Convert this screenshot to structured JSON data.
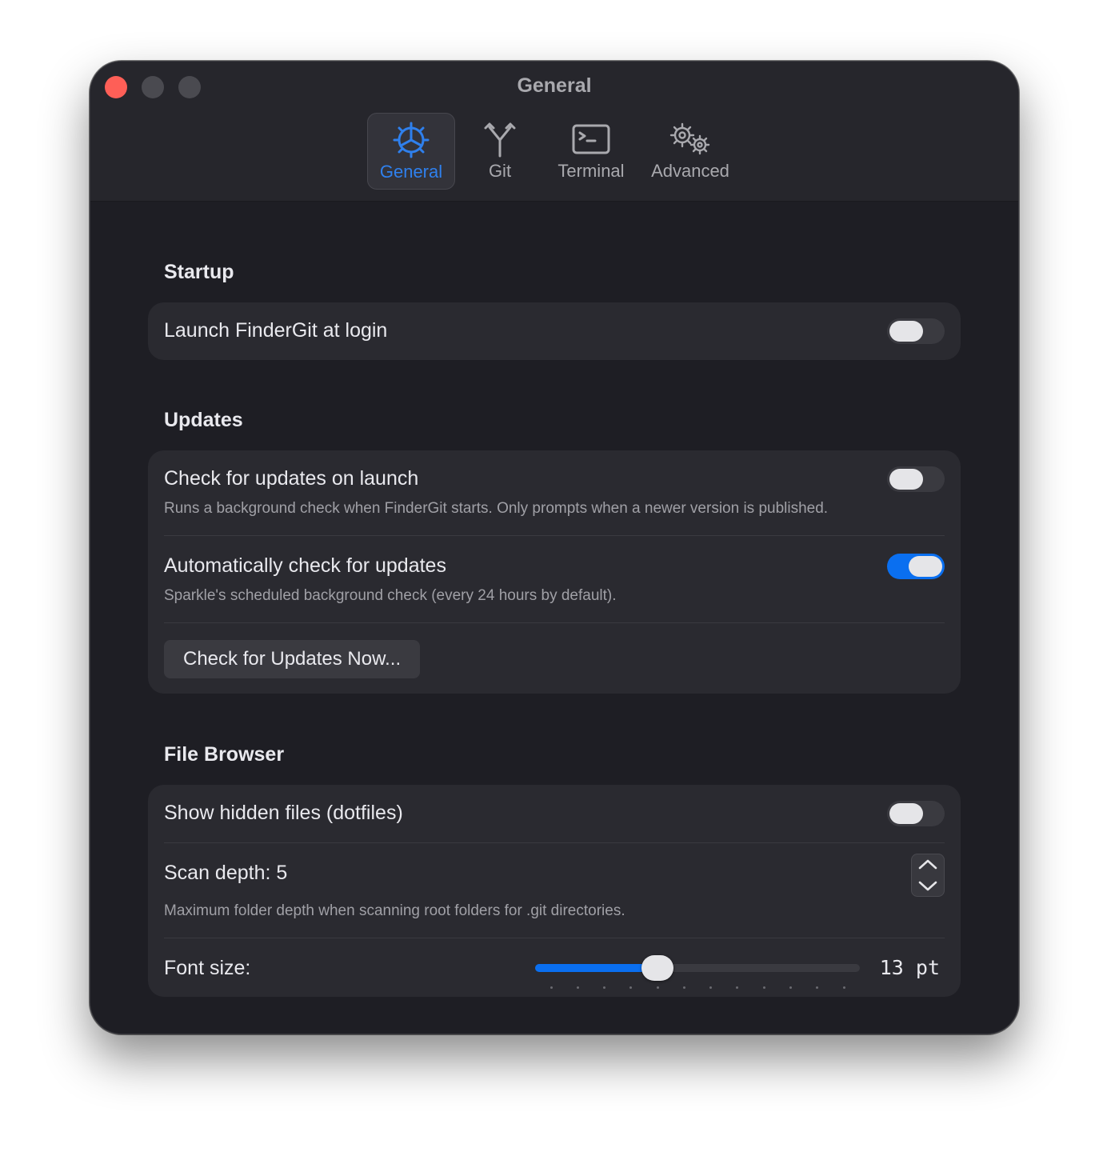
{
  "window": {
    "title": "General"
  },
  "tabs": [
    {
      "label": "General",
      "icon": "general-gear-icon",
      "active": true
    },
    {
      "label": "Git",
      "icon": "git-branch-icon",
      "active": false
    },
    {
      "label": "Terminal",
      "icon": "terminal-icon",
      "active": false
    },
    {
      "label": "Advanced",
      "icon": "gears-icon",
      "active": false
    }
  ],
  "startup": {
    "title": "Startup",
    "launch_at_login": {
      "label": "Launch FinderGit at login",
      "enabled": false
    }
  },
  "updates": {
    "title": "Updates",
    "check_on_launch": {
      "label": "Check for updates on launch",
      "description": "Runs a background check when FinderGit starts. Only prompts when a newer version is published.",
      "enabled": false
    },
    "auto_check": {
      "label": "Automatically check for updates",
      "description": "Sparkle's scheduled background check (every 24 hours by default).",
      "enabled": true
    },
    "check_now_label": "Check for Updates Now..."
  },
  "file_browser": {
    "title": "File Browser",
    "show_hidden": {
      "label": "Show hidden files (dotfiles)",
      "enabled": false
    },
    "scan_depth": {
      "label": "Scan depth: 5",
      "value": 5,
      "description": "Maximum folder depth when scanning root folders for .git directories."
    },
    "font_size": {
      "label": "Font size:",
      "value": 13,
      "min": 9,
      "max": 20,
      "display": "13 pt"
    }
  },
  "colors": {
    "accent": "#0a6ff0",
    "close": "#fe5f57",
    "background": "#1e1e24",
    "card": "#2a2a30"
  }
}
